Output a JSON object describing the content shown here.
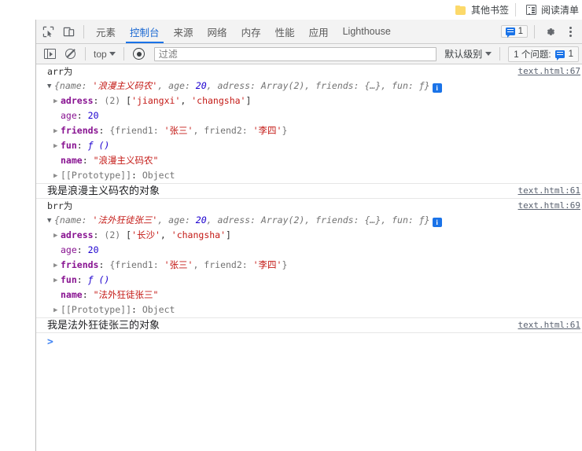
{
  "browser": {
    "bookmarks": [
      {
        "label": "其他书签",
        "icon": "folder-icon"
      },
      {
        "label": "阅读清单",
        "icon": "reading-list-icon"
      }
    ]
  },
  "devtools": {
    "toolbar": {
      "inspect_icon": "inspect-element-icon",
      "device_icon": "device-toolbar-icon",
      "tabs": [
        {
          "label": "元素",
          "active": false
        },
        {
          "label": "控制台",
          "active": true
        },
        {
          "label": "来源",
          "active": false
        },
        {
          "label": "网络",
          "active": false
        },
        {
          "label": "内存",
          "active": false
        },
        {
          "label": "性能",
          "active": false
        },
        {
          "label": "应用",
          "active": false
        },
        {
          "label": "Lighthouse",
          "active": false
        }
      ],
      "issue_count": "1",
      "settings_icon": "gear-icon",
      "more_icon": "kebab-menu-icon"
    },
    "filterbar": {
      "sidebar_toggle_icon": "console-sidebar-icon",
      "clear_icon": "clear-console-icon",
      "context": "top",
      "eye_icon": "live-expression-icon",
      "filter_placeholder": "过滤",
      "filter_value": "",
      "level": "默认级别",
      "issues_label": "1 个问题:",
      "issues_count": "1"
    },
    "console": {
      "groups": [
        {
          "source": "text.html:67",
          "label": "arr为",
          "header_prefix": "{",
          "header_items": [
            {
              "key": "name",
              "sep": ": ",
              "value": "'浪漫主义码农'",
              "type": "string"
            },
            {
              "key": "age",
              "sep": ": ",
              "value": "20",
              "type": "number"
            },
            {
              "key": "adress",
              "sep": ": ",
              "value": "Array(2)",
              "type": "plain"
            },
            {
              "key": "friends",
              "sep": ": ",
              "value": "{…}",
              "type": "plain"
            },
            {
              "key": "fun",
              "sep": ": ",
              "value": "ƒ",
              "type": "plain"
            }
          ],
          "header_suffix": "}",
          "badge": "info-badge",
          "props": [
            {
              "expand": true,
              "key": "adress",
              "bold": true,
              "count": "(2)",
              "value": "['jiangxi', 'changsha']",
              "value_type": "array-strings",
              "items": [
                "'jiangxi'",
                "'changsha'"
              ]
            },
            {
              "expand": false,
              "key": "age",
              "bold": false,
              "count": "",
              "value": "20",
              "value_type": "number"
            },
            {
              "expand": true,
              "key": "friends",
              "bold": true,
              "count": "",
              "value": "{friend1: '张三', friend2: '李四'}",
              "value_type": "object-preview",
              "entries": [
                {
                  "k": "friend1",
                  "v": "'张三'"
                },
                {
                  "k": "friend2",
                  "v": "'李四'"
                }
              ]
            },
            {
              "expand": true,
              "key": "fun",
              "bold": true,
              "count": "",
              "value": "ƒ ()",
              "value_type": "function"
            },
            {
              "expand": false,
              "key": "name",
              "bold": true,
              "count": "",
              "value": "\"浪漫主义码农\"",
              "value_type": "string"
            },
            {
              "expand": true,
              "key": "[[Prototype]]",
              "bold": false,
              "count": "",
              "value": "Object",
              "value_type": "proto"
            }
          ]
        },
        {
          "source": "text.html:61",
          "plain_text": "我是浪漫主义码农的对象"
        },
        {
          "source": "text.html:69",
          "label": "brr为",
          "header_prefix": "{",
          "header_items": [
            {
              "key": "name",
              "sep": ": ",
              "value": "'法外狂徒张三'",
              "type": "string"
            },
            {
              "key": "age",
              "sep": ": ",
              "value": "20",
              "type": "number"
            },
            {
              "key": "adress",
              "sep": ": ",
              "value": "Array(2)",
              "type": "plain"
            },
            {
              "key": "friends",
              "sep": ": ",
              "value": "{…}",
              "type": "plain"
            },
            {
              "key": "fun",
              "sep": ": ",
              "value": "ƒ",
              "type": "plain"
            }
          ],
          "header_suffix": "}",
          "badge": "info-badge",
          "props": [
            {
              "expand": true,
              "key": "adress",
              "bold": true,
              "count": "(2)",
              "value": "['长沙', 'changsha']",
              "value_type": "array-strings",
              "items": [
                "'长沙'",
                "'changsha'"
              ]
            },
            {
              "expand": false,
              "key": "age",
              "bold": false,
              "count": "",
              "value": "20",
              "value_type": "number"
            },
            {
              "expand": true,
              "key": "friends",
              "bold": true,
              "count": "",
              "value": "{friend1: '张三', friend2: '李四'}",
              "value_type": "object-preview",
              "entries": [
                {
                  "k": "friend1",
                  "v": "'张三'"
                },
                {
                  "k": "friend2",
                  "v": "'李四'"
                }
              ]
            },
            {
              "expand": true,
              "key": "fun",
              "bold": true,
              "count": "",
              "value": "ƒ ()",
              "value_type": "function"
            },
            {
              "expand": false,
              "key": "name",
              "bold": true,
              "count": "",
              "value": "\"法外狂徒张三\"",
              "value_type": "string"
            },
            {
              "expand": true,
              "key": "[[Prototype]]",
              "bold": false,
              "count": "",
              "value": "Object",
              "value_type": "proto"
            }
          ]
        },
        {
          "source": "text.html:61",
          "plain_text": "我是法外狂徒张三的对象"
        }
      ],
      "prompt": ">"
    }
  },
  "colors": {
    "accent": "#1a73e8",
    "property": "#881391",
    "string": "#c41a16",
    "number": "#1c00cf",
    "gray": "#737373",
    "link": "#5a6270"
  }
}
